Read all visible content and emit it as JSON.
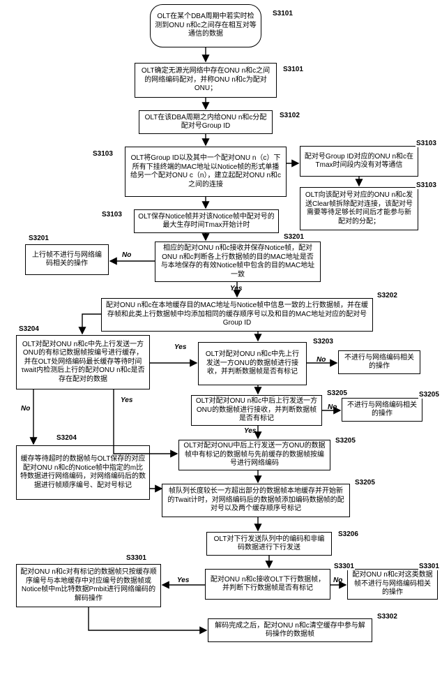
{
  "nodes": {
    "start": "OLT在某个DBA周期中若实时检测到ONU n和c之间存在相互对等通信的数据",
    "n3101a": "OLT确定无源光网络中存在ONU n和c之间的网络编码配对，并称ONU n和c为配对ONU；",
    "n3102": "OLT在该DBA周期之内给ONU n和c分配配对号Group ID",
    "n3103a": "OLT将Group ID以及其中一个配对ONU n（c）下所有下挂终端的MAC地址以Notice帧的形式单播给另一个配对ONU c（n），建立起配对ONU n和c之间的连接",
    "n3103b": "OLT保存Notice帧并对该Notice帧中配对号的最大生存时间Tmax开始计时",
    "n3103c": "配对号Group ID对应的ONU n和c在Tmax时间段内没有对等通信",
    "n3103d": "OLT向该配对号对应的ONU n和c发送Clear帧拆除配对连接，该配对号需要等待足够长时间后才能参与新配对的分配；",
    "n3201a": "相应的配对ONU n和c接收并保存Notice帧，配对ONU n和c判断各上行数据帧的目的MAC地址是否与本地保存的有效Notice帧中包含的目的MAC地址一致",
    "n3201b": "上行帧不进行与网络编码相关的操作",
    "n3202": "配对ONU n和c在本地缓存目的MAC地址与Notice帧中信息一致的上行数据帧，并在缓存帧和此类上行数据帧中均添加相同的缓存顺序号以及和目的MAC地址对应的配对号Group ID",
    "n3203": "OLT对配对ONU n和c中先上行发送一方ONU的数据帧进行接收，并判断数据帧是否有标记",
    "n3203no": "不进行与网络编码相关的操作",
    "n3204a": "OLT对配对ONU n和c中先上行发送一方ONU的有标记数据帧按编号进行缓存，并在OLT处网络编码最长缓存等待时间τwait内检测后上行的配对ONU n和c是否存在配对的数据",
    "n3204b": "缓存等待超时的数据帧与OLT保存的对应配对ONU n和c的Notice帧中指定的m比特数据进行网络编码，对网络编码后的数据进行帧顺序编号、配对号标记",
    "n3205a": "OLT对配对ONU n和c中后上行发送一方ONU的数据帧进行接收，并判断数据帧是否有标记",
    "n3205ano": "不进行与网络编码相关的操作",
    "n3205b": "OLT对配对ONU中后上行发送一方ONU的数据帧中有标记的数据帧与先前缓存的数据帧按编号进行网络编码",
    "n3205c": "帧队列长度较长一方超出部分的数据帧本地缓存并开始新的Twait计时，对网络编码后的数据帧添加编码数据帧的配对号以及两个缓存顺序号标记",
    "n3206": "OLT对下行发送队列中的编码和非编码数据进行下行发送",
    "n3301a": "配对ONU n和c接收OLT下行数据帧，并判断下行数据帧是否有标记",
    "n3301b": "配对ONU n和c对有标记的数据帧只按缓存顺序编号与本地缓存中对应编号的数据帧或Notice帧中m比特数据Pmbit进行网络编码的解码操作",
    "n3301c": "配对ONU n和c对这类数据帧不进行与网络编码相关的操作",
    "n3302": "解码完成之后，配对ONU n和c清空缓存中参与解码操作的数据帧"
  },
  "labels": {
    "s3101": "S3101",
    "s3102": "S3102",
    "s3103": "S3103",
    "s3201": "S3201",
    "s3202": "S3202",
    "s3203": "S3203",
    "s3204": "S3204",
    "s3205": "S3205",
    "s3206": "S3206",
    "s3301": "S3301",
    "s3302": "S3302"
  },
  "yn": {
    "yes": "Yes",
    "no": "No"
  },
  "chart_data": {
    "type": "flowchart",
    "description": "Network coding pair flow for OLT and paired ONUs n and c across DBA cycle",
    "nodes": [
      {
        "id": "start",
        "shape": "terminator",
        "step": "S3101"
      },
      {
        "id": "n3101a",
        "shape": "process",
        "step": "S3101"
      },
      {
        "id": "n3102",
        "shape": "process",
        "step": "S3102"
      },
      {
        "id": "n3103a",
        "shape": "process",
        "step": "S3103"
      },
      {
        "id": "n3103b",
        "shape": "process",
        "step": "S3103"
      },
      {
        "id": "n3103c",
        "shape": "process",
        "step": "S3103"
      },
      {
        "id": "n3103d",
        "shape": "process",
        "step": "S3103"
      },
      {
        "id": "n3201a",
        "shape": "decision-text",
        "step": "S3201"
      },
      {
        "id": "n3201b",
        "shape": "process",
        "step": "S3201"
      },
      {
        "id": "n3202",
        "shape": "process",
        "step": "S3202"
      },
      {
        "id": "n3203",
        "shape": "decision-text",
        "step": "S3203"
      },
      {
        "id": "n3203no",
        "shape": "process"
      },
      {
        "id": "n3204a",
        "shape": "decision-text",
        "step": "S3204"
      },
      {
        "id": "n3204b",
        "shape": "process",
        "step": "S3204"
      },
      {
        "id": "n3205a",
        "shape": "decision-text",
        "step": "S3205"
      },
      {
        "id": "n3205ano",
        "shape": "process",
        "step": "S3205"
      },
      {
        "id": "n3205b",
        "shape": "process",
        "step": "S3205"
      },
      {
        "id": "n3205c",
        "shape": "process",
        "step": "S3205"
      },
      {
        "id": "n3206",
        "shape": "process",
        "step": "S3206"
      },
      {
        "id": "n3301a",
        "shape": "decision-text",
        "step": "S3301"
      },
      {
        "id": "n3301b",
        "shape": "process",
        "step": "S3301"
      },
      {
        "id": "n3301c",
        "shape": "process",
        "step": "S3301"
      },
      {
        "id": "n3302",
        "shape": "process",
        "step": "S3302"
      }
    ],
    "edges": [
      {
        "from": "start",
        "to": "n3101a"
      },
      {
        "from": "n3101a",
        "to": "n3102"
      },
      {
        "from": "n3102",
        "to": "n3103a"
      },
      {
        "from": "n3103a",
        "to": "n3103b"
      },
      {
        "from": "n3103a",
        "to": "n3103c"
      },
      {
        "from": "n3103c",
        "to": "n3103d"
      },
      {
        "from": "n3103b",
        "to": "n3201a"
      },
      {
        "from": "n3201a",
        "to": "n3201b",
        "label": "No"
      },
      {
        "from": "n3201a",
        "to": "n3202",
        "label": "Yes"
      },
      {
        "from": "n3202",
        "to": "n3203"
      },
      {
        "from": "n3202",
        "to": "n3204a"
      },
      {
        "from": "n3203",
        "to": "n3203no",
        "label": "No"
      },
      {
        "from": "n3203",
        "to": "n3205a",
        "label": "Yes"
      },
      {
        "from": "n3204a",
        "to": "n3205b",
        "label": "Yes"
      },
      {
        "from": "n3204a",
        "to": "n3204b",
        "label": "No"
      },
      {
        "from": "n3204b",
        "to": "n3205c"
      },
      {
        "from": "n3205a",
        "to": "n3205ano",
        "label": "No"
      },
      {
        "from": "n3205a",
        "to": "n3205b",
        "label": "Yes"
      },
      {
        "from": "n3205b",
        "to": "n3205c"
      },
      {
        "from": "n3205c",
        "to": "n3206"
      },
      {
        "from": "n3206",
        "to": "n3301a"
      },
      {
        "from": "n3301a",
        "to": "n3301b",
        "label": "Yes"
      },
      {
        "from": "n3301a",
        "to": "n3301c",
        "label": "No"
      },
      {
        "from": "n3301b",
        "to": "n3302"
      }
    ]
  }
}
